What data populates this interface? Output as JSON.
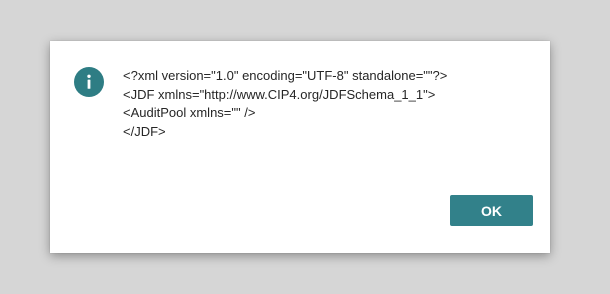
{
  "dialog": {
    "icon": "info-icon",
    "accent_color": "#32818a",
    "message_lines": [
      "<?xml version=\"1.0\" encoding=\"UTF-8\" standalone=\"\"?>",
      "<JDF xmlns=\"http://www.CIP4.org/JDFSchema_1_1\">",
      "<AuditPool xmlns=\"\" />",
      "</JDF>"
    ],
    "ok_label": "OK"
  }
}
